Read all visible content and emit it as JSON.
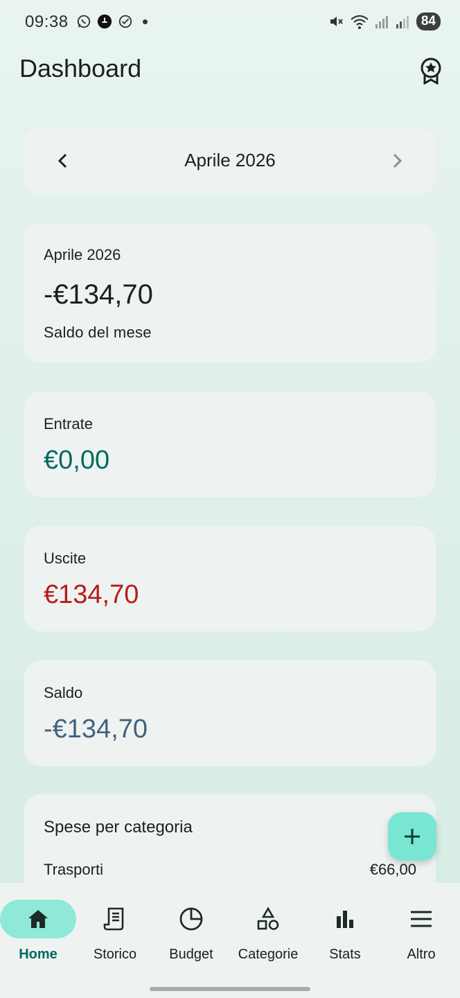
{
  "status_bar": {
    "time": "09:38",
    "battery": "84",
    "icons_left": [
      "whatsapp-icon",
      "notification-icon",
      "check-circle-icon"
    ],
    "icons_right": [
      "mute-icon",
      "wifi-icon",
      "signal-icon",
      "signal-icon"
    ]
  },
  "appbar": {
    "title": "Dashboard",
    "action_icon": "award-icon"
  },
  "month_nav": {
    "label": "Aprile 2026"
  },
  "summary": {
    "label": "Aprile 2026",
    "amount": "-€134,70",
    "subtitle": "Saldo del mese"
  },
  "entrate": {
    "label": "Entrate",
    "amount": "€0,00",
    "color": "#00695f"
  },
  "uscite": {
    "label": "Uscite",
    "amount": "€134,70",
    "color": "#b71c1c"
  },
  "saldo": {
    "label": "Saldo",
    "amount": "-€134,70",
    "color": "#43617f"
  },
  "categories": {
    "title": "Spese per categoria",
    "items": [
      {
        "name": "Trasporti",
        "amount": "€66,00"
      }
    ]
  },
  "fab": {
    "icon": "plus-icon"
  },
  "bottom_nav": {
    "items": [
      {
        "label": "Home",
        "icon": "home-icon",
        "active": true
      },
      {
        "label": "Storico",
        "icon": "receipt-icon",
        "active": false
      },
      {
        "label": "Budget",
        "icon": "pie-chart-icon",
        "active": false
      },
      {
        "label": "Categorie",
        "icon": "shapes-icon",
        "active": false
      },
      {
        "label": "Stats",
        "icon": "bar-chart-icon",
        "active": false
      },
      {
        "label": "Altro",
        "icon": "menu-icon",
        "active": false
      }
    ]
  },
  "colors": {
    "accent": "#00695f",
    "active_pill": "#8fe8d8",
    "fab": "#79e6d2"
  }
}
